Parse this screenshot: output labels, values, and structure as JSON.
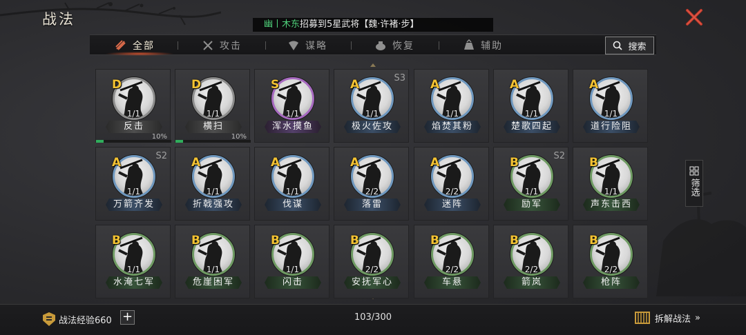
{
  "window": {
    "title": "战法"
  },
  "ticker": {
    "name": "幽丨木东",
    "text": "招募到5星武将【魏·许褚·步】"
  },
  "tabs": [
    {
      "label": "全部",
      "icon": "all-scroll-icon",
      "active": true
    },
    {
      "label": "攻击",
      "icon": "crossed-swords-icon"
    },
    {
      "label": "谋略",
      "icon": "fan-icon"
    },
    {
      "label": "恢复",
      "icon": "medicine-pot-icon"
    },
    {
      "label": "辅助",
      "icon": "pouch-icon"
    }
  ],
  "search": {
    "label": "搜索"
  },
  "filter": {
    "label": "筛选"
  },
  "cards": [
    {
      "grade": "D",
      "count": "1/1",
      "name": "反击",
      "progress": "10%",
      "progress_value": 0.1
    },
    {
      "grade": "D",
      "count": "1/1",
      "name": "横扫",
      "progress": "10%",
      "progress_value": 0.1
    },
    {
      "grade": "S",
      "count": "1/1",
      "name": "浑水摸鱼"
    },
    {
      "grade": "A",
      "count": "1/1",
      "name": "极火佐攻",
      "season": "S3"
    },
    {
      "grade": "A",
      "count": "1/1",
      "name": "焰焚其粉"
    },
    {
      "grade": "A",
      "count": "1/1",
      "name": "楚歌四起"
    },
    {
      "grade": "A",
      "count": "1/1",
      "name": "道行险阻"
    },
    {
      "grade": "A",
      "count": "1/1",
      "name": "万箭齐发",
      "season": "S2"
    },
    {
      "grade": "A",
      "count": "1/1",
      "name": "折戟强攻"
    },
    {
      "grade": "A",
      "count": "1/1",
      "name": "伐谋"
    },
    {
      "grade": "A",
      "count": "2/2",
      "name": "落雷"
    },
    {
      "grade": "A",
      "count": "2/2",
      "name": "迷阵"
    },
    {
      "grade": "B",
      "count": "1/1",
      "name": "励军",
      "season": "S2"
    },
    {
      "grade": "B",
      "count": "1/1",
      "name": "声东击西"
    },
    {
      "grade": "B",
      "count": "1/1",
      "name": "水淹七军"
    },
    {
      "grade": "B",
      "count": "1/1",
      "name": "危崖困军"
    },
    {
      "grade": "B",
      "count": "1/1",
      "name": "闪击"
    },
    {
      "grade": "B",
      "count": "2/2",
      "name": "安抚军心"
    },
    {
      "grade": "B",
      "count": "2/2",
      "name": "车悬"
    },
    {
      "grade": "B",
      "count": "2/2",
      "name": "箭岚"
    },
    {
      "grade": "B",
      "count": "2/2",
      "name": "枪阵"
    }
  ],
  "footer": {
    "exp_label": "战法经验660",
    "plus": "+",
    "count": "103/300",
    "dismantle": "拆解战法"
  },
  "colors": {
    "grade_text": "#f3c232",
    "progress": "#2fae5c",
    "ticker_name": "#4fd07a"
  }
}
